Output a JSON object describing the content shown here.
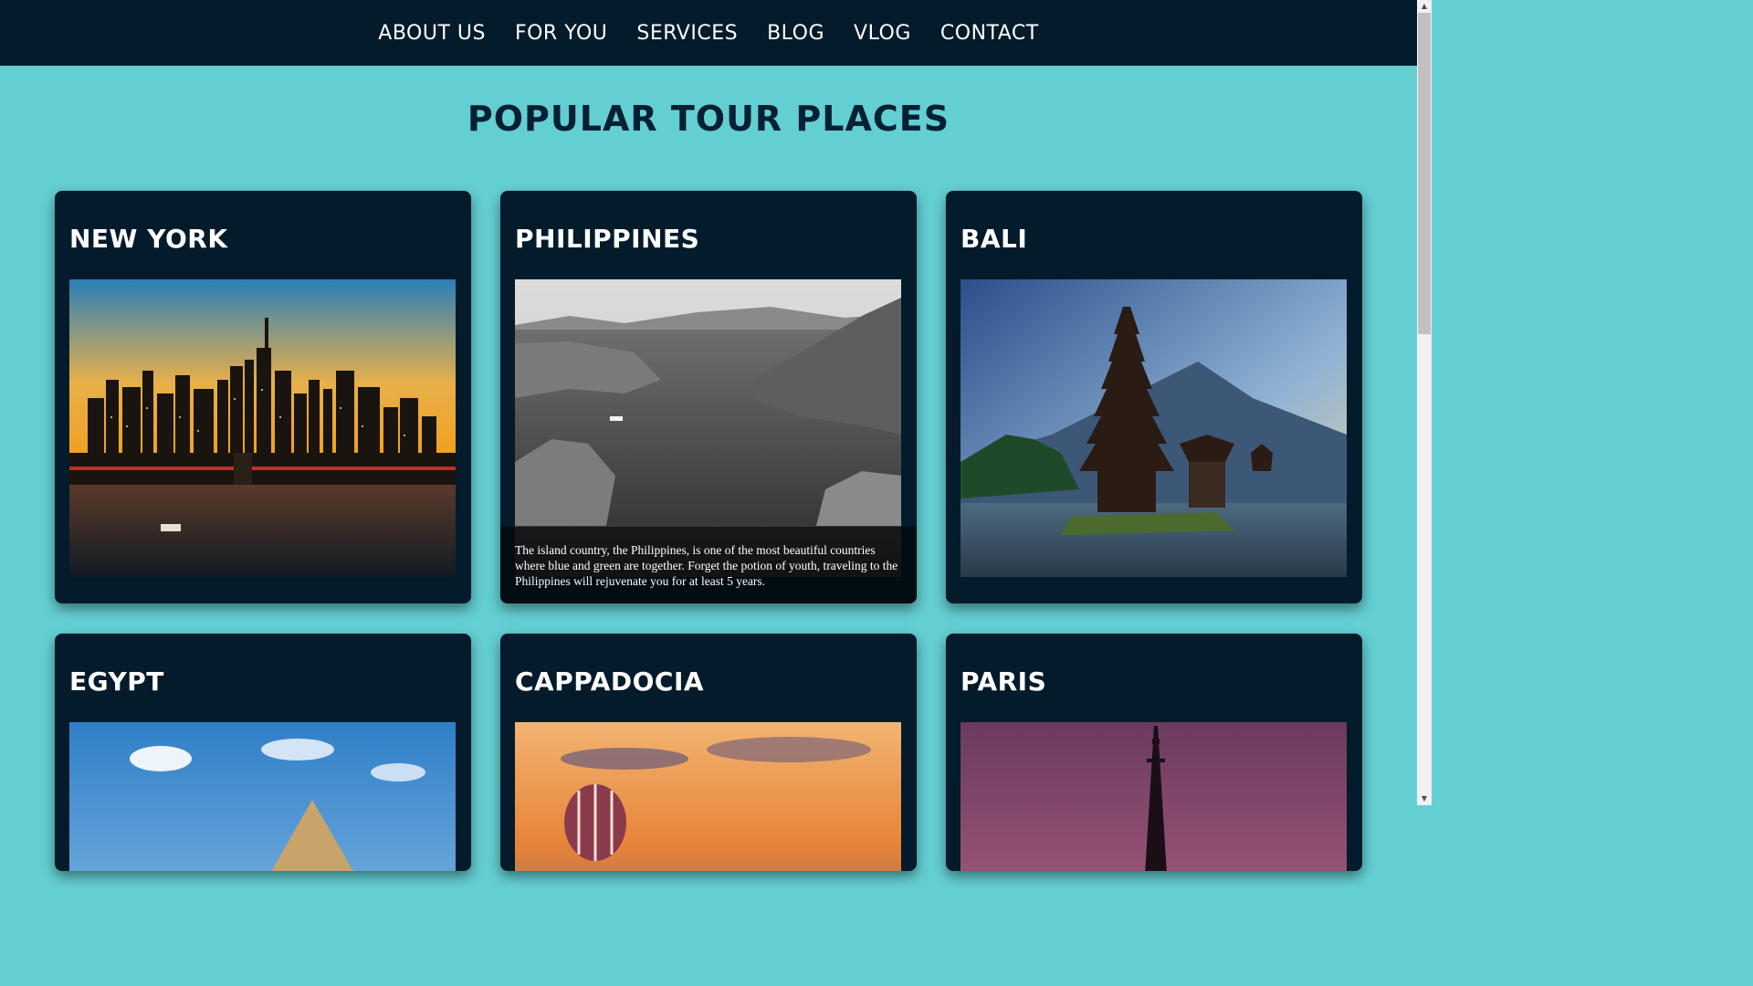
{
  "nav": {
    "items": [
      {
        "label": "ABOUT US"
      },
      {
        "label": "FOR YOU"
      },
      {
        "label": "SERVICES"
      },
      {
        "label": "BLOG"
      },
      {
        "label": "VLOG"
      },
      {
        "label": "CONTACT"
      }
    ]
  },
  "page": {
    "title": "POPULAR TOUR PLACES"
  },
  "cards": [
    {
      "title": "NEW YORK"
    },
    {
      "title": "PHILIPPINES",
      "caption": "The island country, the Philippines, is one of the most beautiful countries where blue and green are together. Forget the potion of youth, traveling to the Philippines will rejuvenate you for at least 5 years."
    },
    {
      "title": "BALI"
    },
    {
      "title": "EGYPT"
    },
    {
      "title": "CAPPADOCIA"
    },
    {
      "title": "PARIS"
    }
  ],
  "colors": {
    "background": "#64cfd3",
    "navbar": "#031b2a",
    "card": "#031b2a",
    "title": "#052033"
  },
  "scrollbar": {
    "up_arrow": "▲",
    "down_arrow": "▼"
  }
}
